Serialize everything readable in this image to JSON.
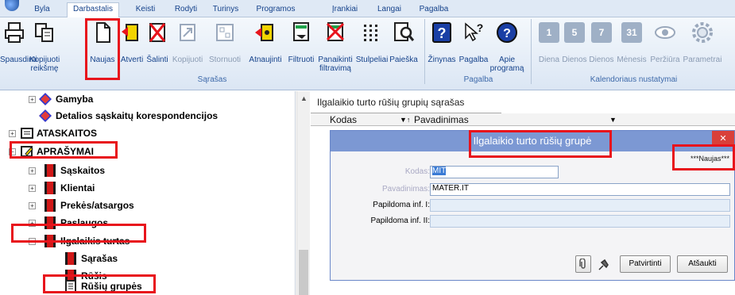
{
  "ribbon": {
    "tabs": [
      "Byla",
      "Darbastalis",
      "Keisti",
      "Rodyti",
      "Turinys",
      "Programos",
      "Įrankiai",
      "Langai",
      "Pagalba"
    ],
    "active_tab": "Darbastalis",
    "buttons": {
      "print": "Spausdinti",
      "copy_value": "Kopijuoti reikšmę",
      "new": "Naujas",
      "open": "Atverti",
      "delete": "Šalinti",
      "copy": "Kopijuoti",
      "reverse": "Stornuoti",
      "refresh": "Atnaujinti",
      "filter": "Filtruoti",
      "clear_filter": "Panaikinti filtravimą",
      "columns": "Stulpeliai",
      "search": "Paieška",
      "directory": "Žinynas",
      "help": "Pagalba",
      "about": "Apie programą",
      "day": "Diena",
      "days": "Dienos",
      "days2": "Dienos",
      "month": "Mėnesis",
      "view": "Peržiūra",
      "params": "Parametrai"
    },
    "groups": {
      "list": "Sąrašas",
      "help": "Pagalba",
      "calendar": "Kalendoriaus nustatymai"
    },
    "calendar_numbers": [
      "1",
      "5",
      "7",
      "31"
    ]
  },
  "tree": {
    "items": [
      {
        "label": "Gamyba"
      },
      {
        "label": "Detalios sąskaitų korespondencijos"
      },
      {
        "label": "ATASKAITOS"
      },
      {
        "label": "APRAŠYMAI"
      },
      {
        "label": "Sąskaitos"
      },
      {
        "label": "Klientai"
      },
      {
        "label": "Prekės/atsargos"
      },
      {
        "label": "Paslaugos"
      },
      {
        "label": "Ilgalaikis turtas"
      },
      {
        "label": "Sąrašas"
      },
      {
        "label": "Rūšis"
      },
      {
        "label": "Rūšių grupės"
      }
    ]
  },
  "list": {
    "title": "Ilgalaikio turto rūšių grupių sąrašas",
    "columns": [
      "Kodas",
      "Pavadinimas"
    ]
  },
  "dialog": {
    "title": "Ilgalaikio turto rūšių grupė",
    "status": "***Naujas***",
    "fields": {
      "code_label": "Kodas:",
      "code_value": "MIT",
      "name_label": "Pavadinimas:",
      "name_value": "MATER.IT",
      "extra1_label": "Papildoma inf. I:",
      "extra2_label": "Papildoma inf. II:"
    },
    "confirm": "Patvirtinti",
    "cancel": "Atšaukti",
    "close_glyph": "✕"
  }
}
